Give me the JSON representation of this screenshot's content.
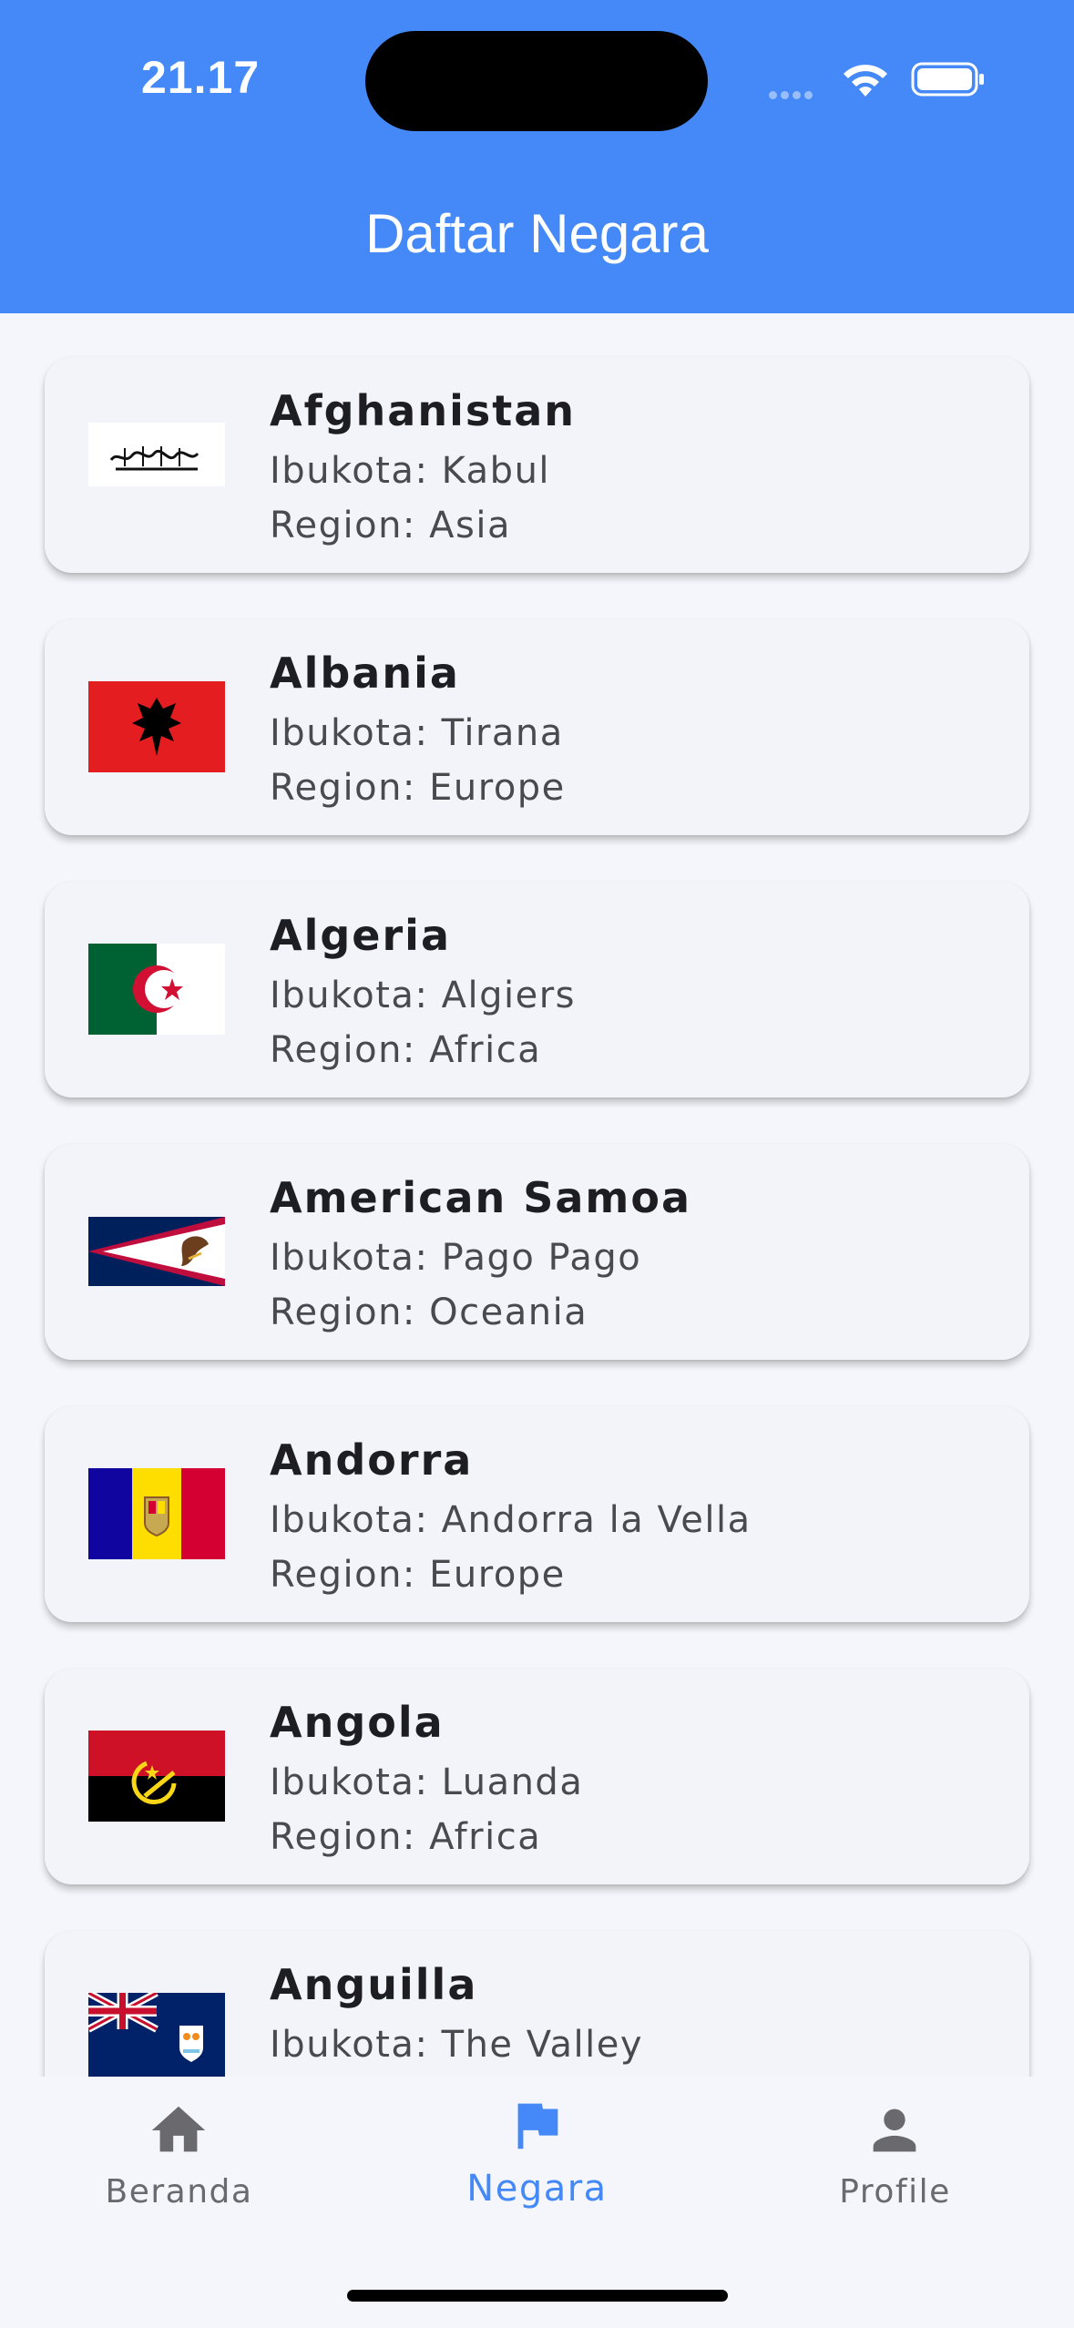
{
  "status_bar": {
    "time": "21.17",
    "icons": [
      "cellular-signal-icon",
      "wifi-icon",
      "battery-icon"
    ]
  },
  "header": {
    "title": "Daftar Negara",
    "background_color": "#4489F7"
  },
  "countries": [
    {
      "name": "Afghanistan",
      "capital": "Ibukota: Kabul",
      "region": "Region: Asia",
      "flag_icon": "afghanistan-flag-icon"
    },
    {
      "name": "Albania",
      "capital": "Ibukota: Tirana",
      "region": "Region: Europe",
      "flag_icon": "albania-flag-icon"
    },
    {
      "name": "Algeria",
      "capital": "Ibukota: Algiers",
      "region": "Region: Africa",
      "flag_icon": "algeria-flag-icon"
    },
    {
      "name": "American Samoa",
      "capital": "Ibukota: Pago Pago",
      "region": "Region: Oceania",
      "flag_icon": "american-samoa-flag-icon"
    },
    {
      "name": "Andorra",
      "capital": "Ibukota: Andorra la Vella",
      "region": "Region: Europe",
      "flag_icon": "andorra-flag-icon"
    },
    {
      "name": "Angola",
      "capital": "Ibukota: Luanda",
      "region": "Region: Africa",
      "flag_icon": "angola-flag-icon"
    },
    {
      "name": "Anguilla",
      "capital": "Ibukota: The Valley",
      "region": "",
      "flag_icon": "anguilla-flag-icon"
    }
  ],
  "bottom_nav": {
    "items": [
      {
        "label": "Beranda",
        "icon": "home-icon",
        "active": false
      },
      {
        "label": "Negara",
        "icon": "flag-icon",
        "active": true
      },
      {
        "label": "Profile",
        "icon": "person-icon",
        "active": false
      }
    ],
    "active_color": "#4489F7",
    "inactive_color": "#6A6A6E"
  }
}
